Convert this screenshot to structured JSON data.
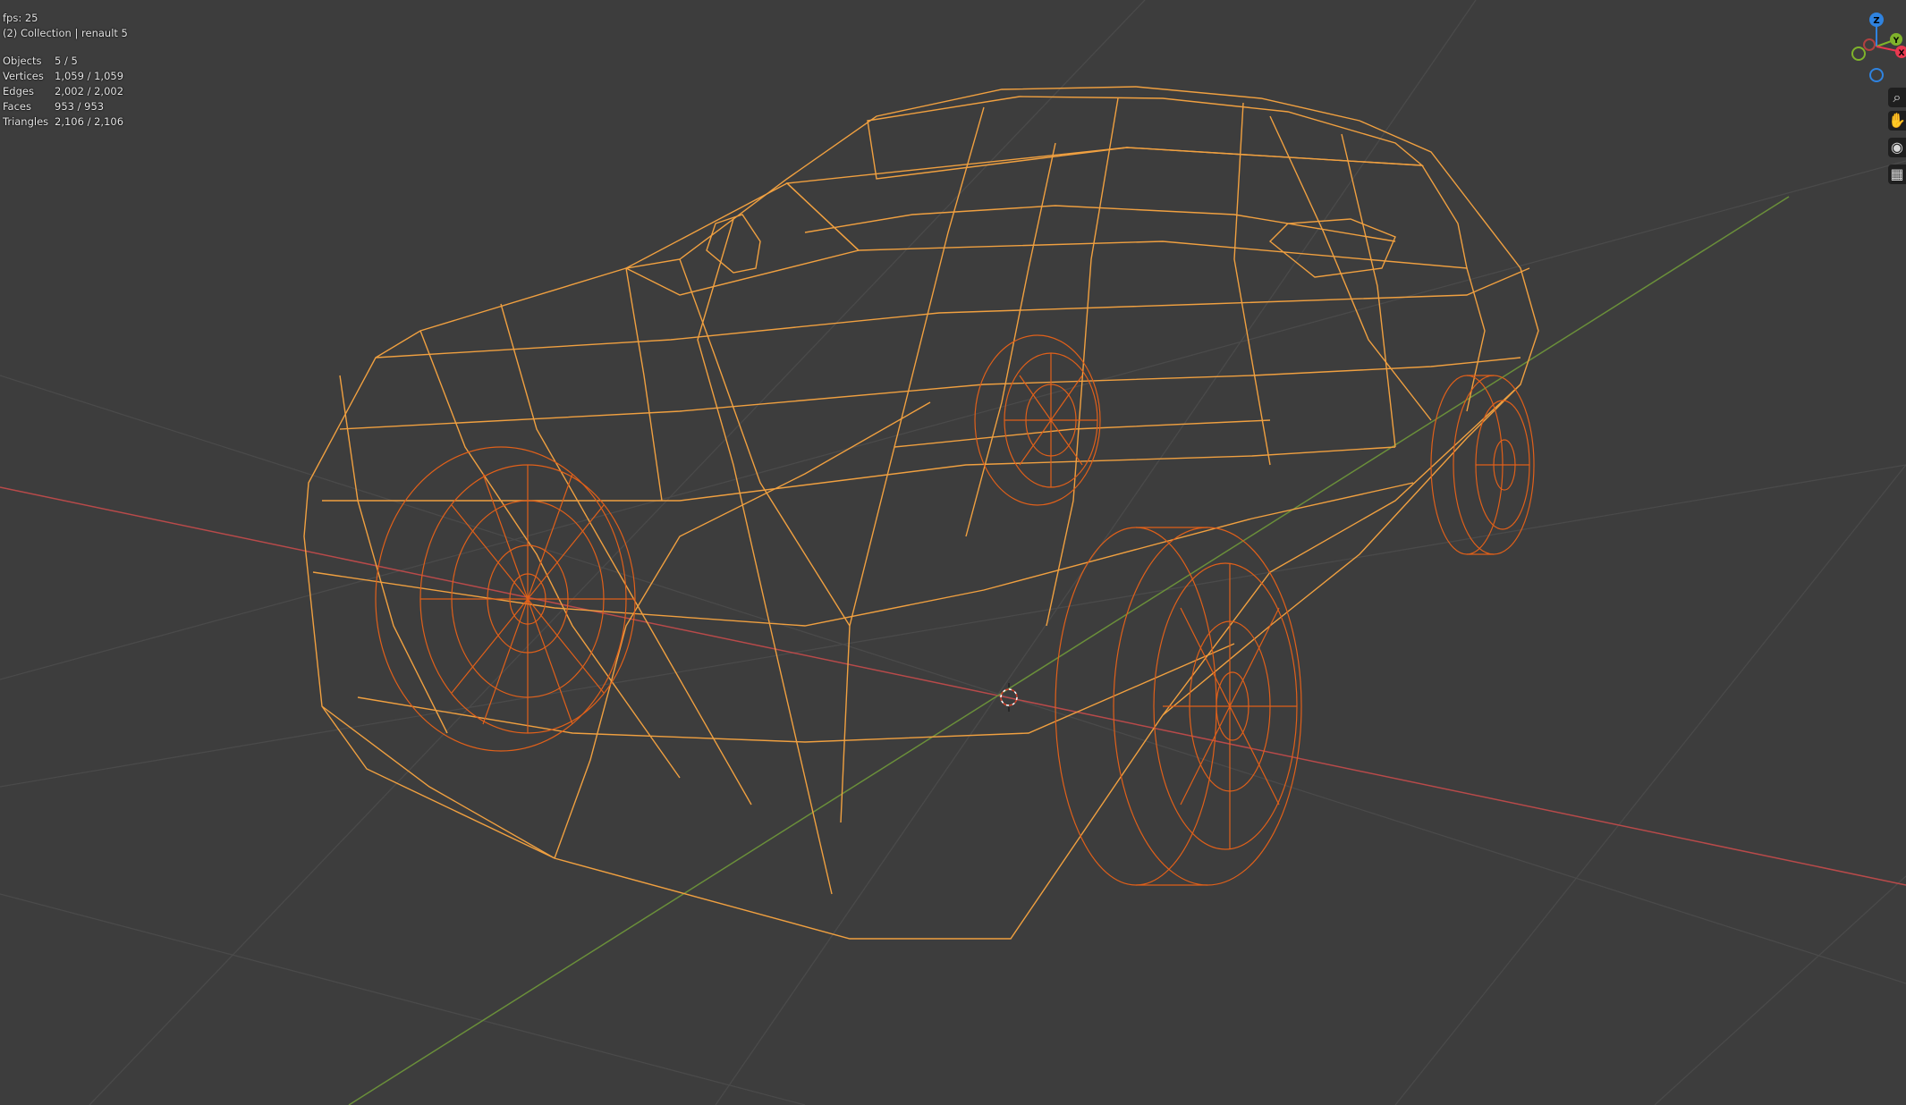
{
  "overlay": {
    "fps": "fps: 25",
    "collection": "(2) Collection | renault 5",
    "stats": [
      {
        "label": "Objects",
        "value": "5 / 5"
      },
      {
        "label": "Vertices",
        "value": "1,059 / 1,059"
      },
      {
        "label": "Edges",
        "value": "2,002 / 2,002"
      },
      {
        "label": "Faces",
        "value": "953 / 953"
      },
      {
        "label": "Triangles",
        "value": "2,106 / 2,106"
      }
    ]
  },
  "gizmo": {
    "z_label": "Z",
    "y_label": "Y",
    "x_label": "X",
    "colors": {
      "x": "#e8384f",
      "y": "#7fb32b",
      "z": "#2f83e0"
    }
  },
  "nav_buttons": [
    {
      "icon": "zoom-icon",
      "glyph": "⌕"
    },
    {
      "icon": "pan-hand-icon",
      "glyph": "✋"
    },
    {
      "icon": "camera-icon",
      "glyph": "◉"
    },
    {
      "icon": "grid-ortho-icon",
      "glyph": "▦"
    }
  ],
  "colors": {
    "background": "#3d3d3d",
    "grid": "#4a4a4a",
    "x_axis": "#b84a4a",
    "y_axis": "#6a8f3a",
    "body_wire": "#f0a040",
    "wheel_wire": "#e0601a"
  }
}
